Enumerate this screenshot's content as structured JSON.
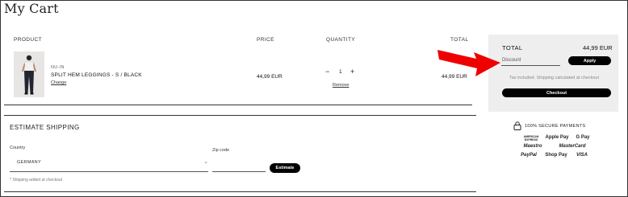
{
  "page": {
    "title": "My Cart"
  },
  "table": {
    "headers": {
      "product": "PRODUCT",
      "price": "PRICE",
      "quantity": "QUANTITY",
      "total": "TOTAL"
    }
  },
  "cart_item": {
    "brand": "NU-IN",
    "name": "SPLIT HEM LEGGINGS - S / BLACK",
    "change_label": "Change",
    "price": "44,99 EUR",
    "quantity": "1",
    "minus": "−",
    "plus": "+",
    "remove_label": "Remove",
    "total": "44,99 EUR"
  },
  "shipping": {
    "title": "ESTIMATE SHIPPING",
    "country_label": "Country",
    "country_value": "GERMANY",
    "zip_label": "Zip code",
    "zip_value": "",
    "estimate_label": "Estimate",
    "note": "* Shipping added at checkout"
  },
  "summary": {
    "total_label": "TOTAL",
    "total_value": "44,99 EUR",
    "discount_placeholder": "Discount",
    "apply_label": "Apply",
    "tax_note": "Tax included. Shipping calculated at checkout",
    "checkout_label": "Checkout"
  },
  "payments": {
    "secure_label": "100% SECURE PAYMENTS",
    "logos": [
      "AMERICAN EXPRESS",
      "Apple Pay",
      "G Pay",
      "Maestro",
      "MasterCard",
      "PayPal",
      "Shop Pay",
      "VISA"
    ]
  },
  "colors": {
    "annotation_arrow": "#ee0000",
    "summary_bg": "#eeeeee",
    "button_bg": "#000000"
  }
}
